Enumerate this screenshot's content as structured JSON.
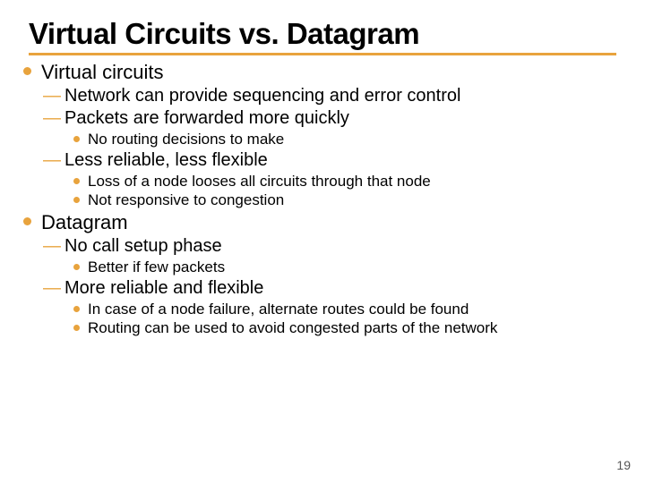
{
  "title": "Virtual Circuits vs. Datagram",
  "sections": [
    {
      "label": "Virtual circuits",
      "subs": [
        {
          "label": "Network can provide sequencing and error control",
          "items": []
        },
        {
          "label": "Packets are forwarded more quickly",
          "items": [
            "No routing decisions to make"
          ]
        },
        {
          "label": "Less reliable, less flexible",
          "items": [
            "Loss of a node looses all circuits through that node",
            "Not responsive to congestion"
          ]
        }
      ]
    },
    {
      "label": "Datagram",
      "subs": [
        {
          "label": "No call setup phase",
          "items": [
            "Better if few packets"
          ]
        },
        {
          "label": "More reliable and flexible",
          "items": [
            "In case of a node failure, alternate routes could be found",
            "Routing can be used to avoid congested parts of the network"
          ]
        }
      ]
    }
  ],
  "page_number": "19",
  "colors": {
    "accent": "#e8a33d"
  }
}
